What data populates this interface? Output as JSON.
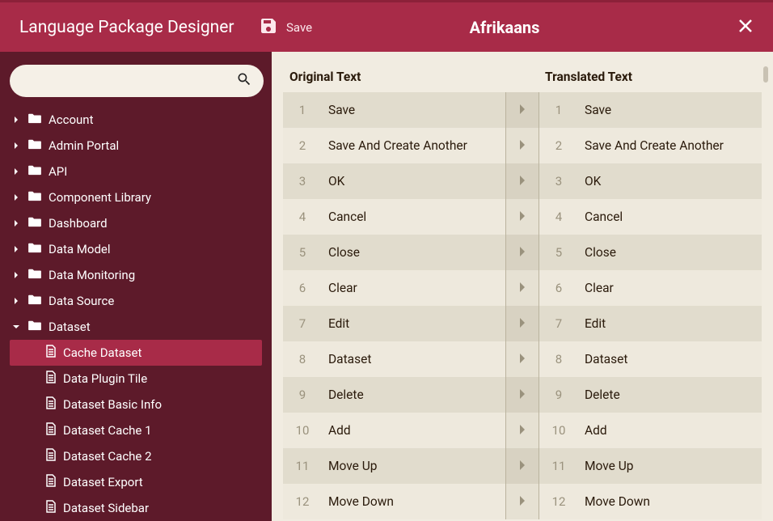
{
  "header": {
    "app_title": "Language Package Designer",
    "save_label": "Save",
    "language_title": "Afrikaans"
  },
  "search": {
    "placeholder": ""
  },
  "sidebar": {
    "items": [
      {
        "label": "Account",
        "type": "folder",
        "expanded": false
      },
      {
        "label": "Admin Portal",
        "type": "folder",
        "expanded": false
      },
      {
        "label": "API",
        "type": "folder",
        "expanded": false
      },
      {
        "label": "Component Library",
        "type": "folder",
        "expanded": false
      },
      {
        "label": "Dashboard",
        "type": "folder",
        "expanded": false
      },
      {
        "label": "Data Model",
        "type": "folder",
        "expanded": false
      },
      {
        "label": "Data Monitoring",
        "type": "folder",
        "expanded": false
      },
      {
        "label": "Data Source",
        "type": "folder",
        "expanded": false
      },
      {
        "label": "Dataset",
        "type": "folder",
        "expanded": true,
        "children": [
          {
            "label": "Cache Dataset",
            "type": "file",
            "selected": true
          },
          {
            "label": "Data Plugin Tile",
            "type": "file"
          },
          {
            "label": "Dataset Basic Info",
            "type": "file"
          },
          {
            "label": "Dataset Cache 1",
            "type": "file"
          },
          {
            "label": "Dataset Cache 2",
            "type": "file"
          },
          {
            "label": "Dataset Export",
            "type": "file"
          },
          {
            "label": "Dataset Sidebar",
            "type": "file"
          }
        ]
      }
    ]
  },
  "columns": {
    "original": "Original Text",
    "translated": "Translated Text"
  },
  "rows": [
    {
      "n": 1,
      "original": "Save",
      "translated": "Save"
    },
    {
      "n": 2,
      "original": "Save And Create Another",
      "translated": "Save And Create Another"
    },
    {
      "n": 3,
      "original": "OK",
      "translated": "OK"
    },
    {
      "n": 4,
      "original": "Cancel",
      "translated": "Cancel"
    },
    {
      "n": 5,
      "original": "Close",
      "translated": "Close"
    },
    {
      "n": 6,
      "original": "Clear",
      "translated": "Clear"
    },
    {
      "n": 7,
      "original": "Edit",
      "translated": "Edit"
    },
    {
      "n": 8,
      "original": "Dataset",
      "translated": "Dataset"
    },
    {
      "n": 9,
      "original": "Delete",
      "translated": "Delete"
    },
    {
      "n": 10,
      "original": "Add",
      "translated": "Add"
    },
    {
      "n": 11,
      "original": "Move Up",
      "translated": "Move Up"
    },
    {
      "n": 12,
      "original": "Move Down",
      "translated": "Move Down"
    }
  ]
}
